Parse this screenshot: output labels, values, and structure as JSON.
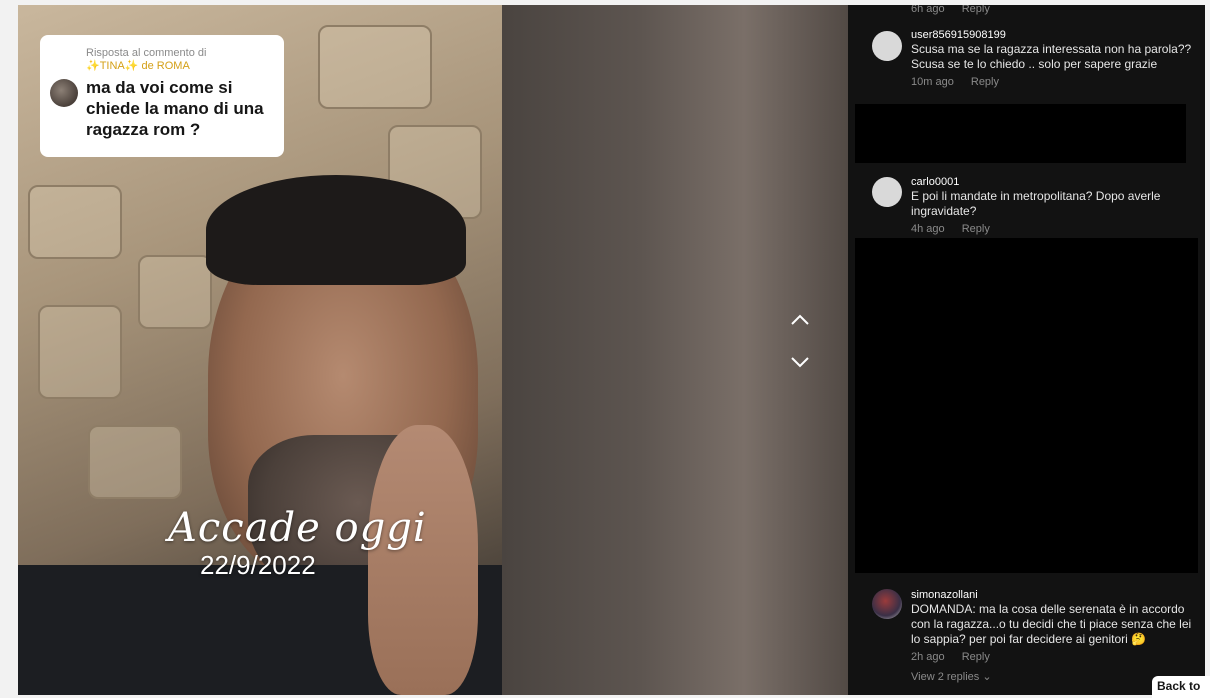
{
  "video": {
    "reply_header_prefix": "Risposta al commento di",
    "reply_header_user": "✨TINA✨ de ROMA",
    "reply_text": "ma da voi come si chiede la mano di una ragazza rom ?",
    "overlay_cursive": "Accade oggi",
    "overlay_date": "22/9/2022"
  },
  "nav": {
    "up_icon": "chevron-up-icon",
    "down_icon": "chevron-down-icon"
  },
  "comments": {
    "top_meta_time": "6h ago",
    "top_meta_reply": "Reply",
    "items": [
      {
        "user": "user856915908199",
        "text": "Scusa ma se la ragazza interessata non ha parola?? Scusa se te lo chiedo .. solo per sapere grazie",
        "time": "10m ago",
        "reply": "Reply"
      },
      {
        "user": "carlo0001",
        "text": "E poi li mandate in metropolitana? Dopo averle ingravidate?",
        "time": "4h ago",
        "reply": "Reply"
      },
      {
        "user": "simonazollani",
        "text": "DOMANDA: ma la cosa delle serenata è in accordo con la ragazza...o tu decidi che ti piace senza che lei lo sappia? per poi far decidere ai genitori 🤔",
        "time": "2h ago",
        "reply": "Reply",
        "view_replies": "View 2 replies ⌄"
      }
    ]
  },
  "back_to_label": "Back to",
  "colors": {
    "panel_bg": "#121212",
    "accent_tina": "#d4a017"
  }
}
